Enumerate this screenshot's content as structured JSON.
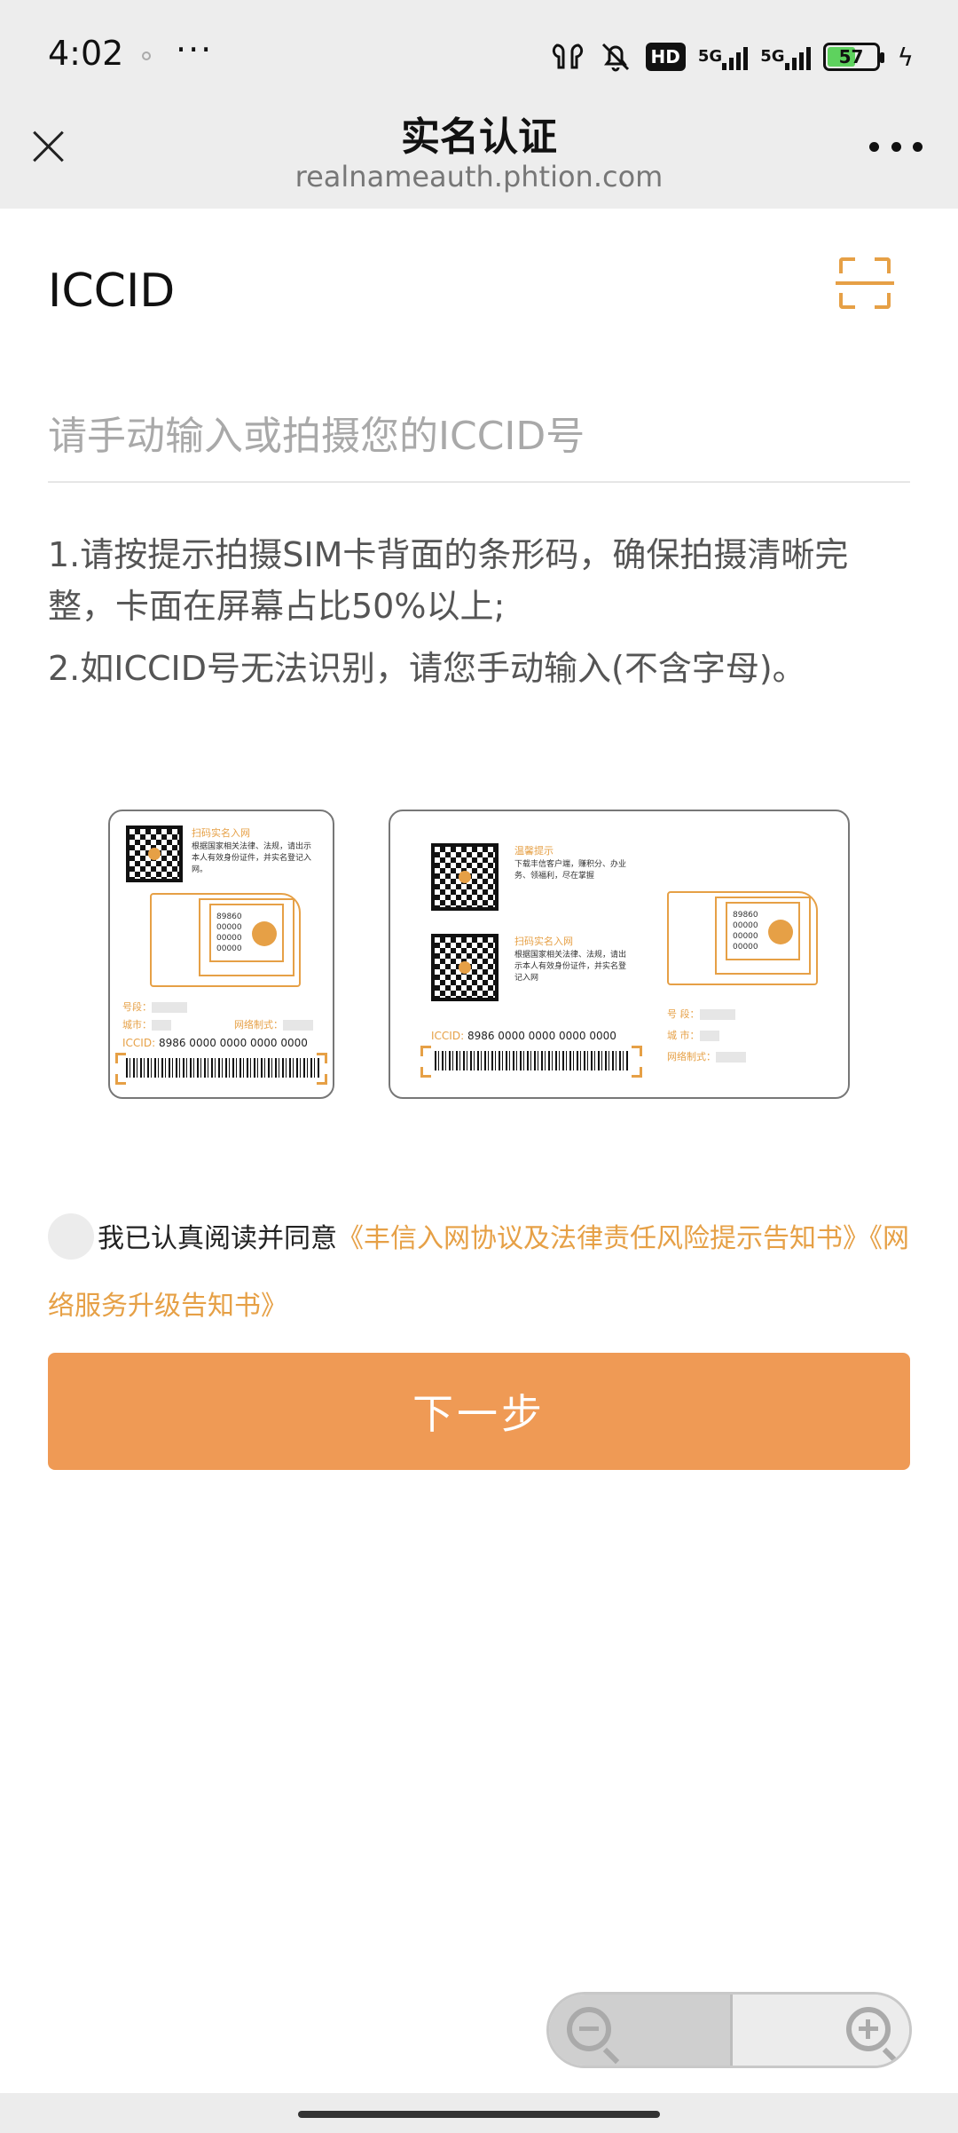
{
  "status_bar": {
    "time": "4:02",
    "more": "···",
    "network1": "5G",
    "network2": "5G",
    "hd": "HD",
    "battery": "57",
    "icons": [
      "earbuds-icon",
      "mute-icon",
      "hd-icon",
      "signal-icon",
      "signal-icon",
      "battery-icon",
      "charging-icon"
    ]
  },
  "header": {
    "title": "实名认证",
    "url": "realnameauth.phtion.com"
  },
  "form": {
    "label": "ICCID",
    "placeholder": "请手动输入或拍摄您的ICCID号",
    "value": ""
  },
  "tips": [
    "1.请按提示拍摄SIM卡背面的条形码，确保拍摄清晰完整，卡面在屏幕占比50%以上;",
    "2.如ICCID号无法识别，请您手动输入(不含字母)。"
  ],
  "card_illustration": {
    "card1": {
      "title": "扫码实名入网",
      "desc": "根据国家相关法律、法规，请出示本人有效身份证件，并实名登记入网。",
      "chip_numbers": [
        "89860",
        "00000",
        "00000",
        "00000"
      ],
      "number_label": "号段：",
      "city_label": "城市：",
      "system_label": "网络制式：",
      "iccid_label": "ICCID:",
      "iccid_value": "8986 0000 0000 0000 0000"
    },
    "card2": {
      "tip_title": "温馨提示",
      "tip_desc": "下载丰信客户端，赚积分、办业务、领福利，尽在掌握",
      "title": "扫码实名入网",
      "desc": "根据国家相关法律、法规，请出示本人有效身份证件，并实名登记入网",
      "chip_numbers": [
        "89860",
        "00000",
        "00000",
        "00000"
      ],
      "number_label": "号 段：",
      "city_label": "城 市：",
      "system_label": "网络制式：",
      "iccid_label": "ICCID:",
      "iccid_value": "8986 0000 0000 0000 0000"
    }
  },
  "agreement": {
    "prefix": "我已认真阅读并同意",
    "link1": "《丰信入网协议及法律责任风险提示告知书》",
    "link2": "《网络服务升级告知书》",
    "checked": false
  },
  "next_button": "下一步",
  "colors": {
    "accent": "#e6a046",
    "button": "#ef9a55",
    "header_bg": "#ededed"
  }
}
